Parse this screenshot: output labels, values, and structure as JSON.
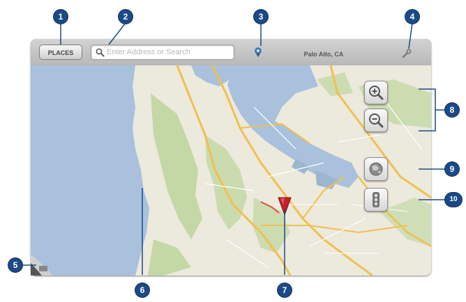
{
  "toolbar": {
    "places_label": "PLACES",
    "search_placeholder": "Enter Address or Search",
    "location_label": "Palo Alto, CA",
    "icons": {
      "search": "magnifier-icon",
      "gps": "gps-locator-icon",
      "settings": "wrench-icon"
    }
  },
  "map_controls": {
    "zoom_in": "zoom-in-icon",
    "zoom_out": "zoom-out-icon",
    "layers": "globe-icon",
    "traffic": "traffic-light-icon"
  },
  "callouts": [
    "1",
    "2",
    "3",
    "4",
    "5",
    "6",
    "7",
    "8",
    "9",
    "10"
  ],
  "colors": {
    "callout": "#1b4a86",
    "water": "#a9c1dc",
    "land": "#ece9dd",
    "park": "#c4d8a6",
    "highway": "#f1c04e",
    "pin": "#c8202a"
  }
}
